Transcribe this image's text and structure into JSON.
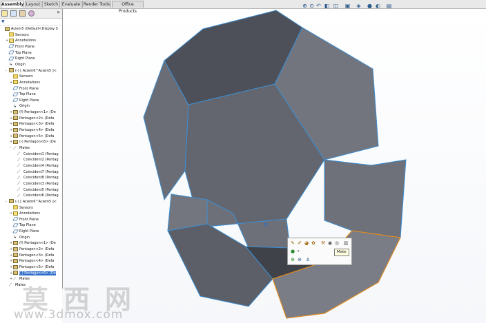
{
  "tabs": [
    {
      "label": "Assembly",
      "active": true
    },
    {
      "label": "Layout",
      "active": false
    },
    {
      "label": "Sketch",
      "active": false
    },
    {
      "label": "Evaluate",
      "active": false
    },
    {
      "label": "Render Tools",
      "active": false
    },
    {
      "label": "Office Products",
      "active": false
    }
  ],
  "panel": {
    "expand_glyph": "»",
    "filter_glyph": "▼"
  },
  "tree": [
    {
      "label": "Aciem5  (Default<Display S",
      "icon": "part",
      "expander": "",
      "indent": 0
    },
    {
      "label": "Sensors",
      "icon": "folder",
      "expander": "",
      "indent": 1
    },
    {
      "label": "Annotations",
      "icon": "annot",
      "expander": "+",
      "indent": 1
    },
    {
      "label": "Front Plane",
      "icon": "plane",
      "expander": "",
      "indent": 1
    },
    {
      "label": "Top Plane",
      "icon": "plane",
      "expander": "",
      "indent": 1
    },
    {
      "label": "Right Plane",
      "icon": "plane",
      "expander": "",
      "indent": 1
    },
    {
      "label": "Origin",
      "icon": "origin",
      "expander": "",
      "indent": 1
    },
    {
      "label": "(-) [ Aciem6^Aciem5 ]<",
      "icon": "part",
      "expander": "-",
      "indent": 1
    },
    {
      "label": "Sensors",
      "icon": "folder",
      "expander": "",
      "indent": 2
    },
    {
      "label": "Annotations",
      "icon": "annot",
      "expander": "+",
      "indent": 2
    },
    {
      "label": "Front Plane",
      "icon": "plane",
      "expander": "",
      "indent": 2
    },
    {
      "label": "Top Plane",
      "icon": "plane",
      "expander": "",
      "indent": 2
    },
    {
      "label": "Right Plane",
      "icon": "plane",
      "expander": "",
      "indent": 2
    },
    {
      "label": "Origin",
      "icon": "origin",
      "expander": "",
      "indent": 2
    },
    {
      "label": "(f) Pentagon<1> (De",
      "icon": "part",
      "expander": "+",
      "indent": 2
    },
    {
      "label": "Pentagon<2> (Defa",
      "icon": "part",
      "expander": "+",
      "indent": 2
    },
    {
      "label": "Pentagon<3> (Defa",
      "icon": "part",
      "expander": "+",
      "indent": 2
    },
    {
      "label": "Pentagon<4> (Defa",
      "icon": "part",
      "expander": "+",
      "indent": 2
    },
    {
      "label": "Pentagon<5> (Defa",
      "icon": "part",
      "expander": "+",
      "indent": 2
    },
    {
      "label": "(-) Pentagon<6> (De",
      "icon": "part",
      "expander": "+",
      "indent": 2
    },
    {
      "label": "Mates",
      "icon": "mate",
      "expander": "-",
      "indent": 2
    },
    {
      "label": "Coincident1 (Pentag",
      "icon": "mate",
      "expander": "",
      "indent": 3
    },
    {
      "label": "Coincident2 (Pentag",
      "icon": "mate",
      "expander": "",
      "indent": 3
    },
    {
      "label": "Coincident4 (Pentag",
      "icon": "mate",
      "expander": "",
      "indent": 3
    },
    {
      "label": "Coincident7 (Pentag",
      "icon": "mate",
      "expander": "",
      "indent": 3
    },
    {
      "label": "Coincident8 (Pentag",
      "icon": "mate",
      "expander": "",
      "indent": 3
    },
    {
      "label": "Coincident3 (Pentag",
      "icon": "mate",
      "expander": "",
      "indent": 3
    },
    {
      "label": "Coincident5 (Pentag",
      "icon": "mate",
      "expander": "",
      "indent": 3
    },
    {
      "label": "Coincident6 (Pentag",
      "icon": "mate",
      "expander": "",
      "indent": 3
    },
    {
      "label": "(-) [ Aciem6^Aciem5 ]<",
      "icon": "part",
      "expander": "-",
      "indent": 1
    },
    {
      "label": "Sensors",
      "icon": "folder",
      "expander": "",
      "indent": 2
    },
    {
      "label": "Annotations",
      "icon": "annot",
      "expander": "+",
      "indent": 2
    },
    {
      "label": "Front Plane",
      "icon": "plane",
      "expander": "",
      "indent": 2
    },
    {
      "label": "Top Plane",
      "icon": "plane",
      "expander": "",
      "indent": 2
    },
    {
      "label": "Right Plane",
      "icon": "plane",
      "expander": "",
      "indent": 2
    },
    {
      "label": "Origin",
      "icon": "origin",
      "expander": "",
      "indent": 2
    },
    {
      "label": "(f) Pentagon<1> (De",
      "icon": "part",
      "expander": "+",
      "indent": 2
    },
    {
      "label": "Pentagon<2> (Defa",
      "icon": "part",
      "expander": "+",
      "indent": 2
    },
    {
      "label": "Pentagon<3> (Defa",
      "icon": "part",
      "expander": "+",
      "indent": 2
    },
    {
      "label": "Pentagon<4> (Defa",
      "icon": "part",
      "expander": "+",
      "indent": 2
    },
    {
      "label": "Pentagon<5> (Defa",
      "icon": "part",
      "expander": "+",
      "indent": 2
    },
    {
      "label": "(-) Pentagon<6> (De",
      "icon": "part",
      "expander": "+",
      "indent": 2,
      "selected": true
    },
    {
      "label": "Mates",
      "icon": "mate",
      "expander": "+",
      "indent": 2
    },
    {
      "label": "Mates",
      "icon": "mate",
      "expander": "",
      "indent": 1
    }
  ],
  "heads_up_icons": [
    "zoom-to-fit-icon",
    "zoom-area-icon",
    "previous-view-icon",
    "section-view-icon",
    "view-orientation-icon",
    "display-style-icon",
    "hide-show-icon",
    "edit-appearance-icon",
    "apply-scene-icon",
    "view-settings-icon"
  ],
  "context_toolbar": {
    "row1_icons": [
      "mate-icon",
      "edit-part-icon",
      "open-part-icon",
      "insert-component-icon",
      "assembly-transparency-icon",
      "hide-components-icon",
      "change-transparency-icon",
      "float-icon"
    ],
    "row2_icons": [
      "appearance-icon"
    ],
    "row3_icons": [
      "zoom-to-selection-icon",
      "rotate-icon",
      "origin-icon"
    ]
  },
  "tooltip": "Mate",
  "watermark": {
    "chinese": "莫西网",
    "url": "www.3dmox.com"
  },
  "colors": {
    "face": "#6b6e76",
    "face_dark": "#4c4f57",
    "edge_selected": "#3c8fd6",
    "edge_highlight": "#e08a1e",
    "tree_selection": "#2f6fc9"
  }
}
